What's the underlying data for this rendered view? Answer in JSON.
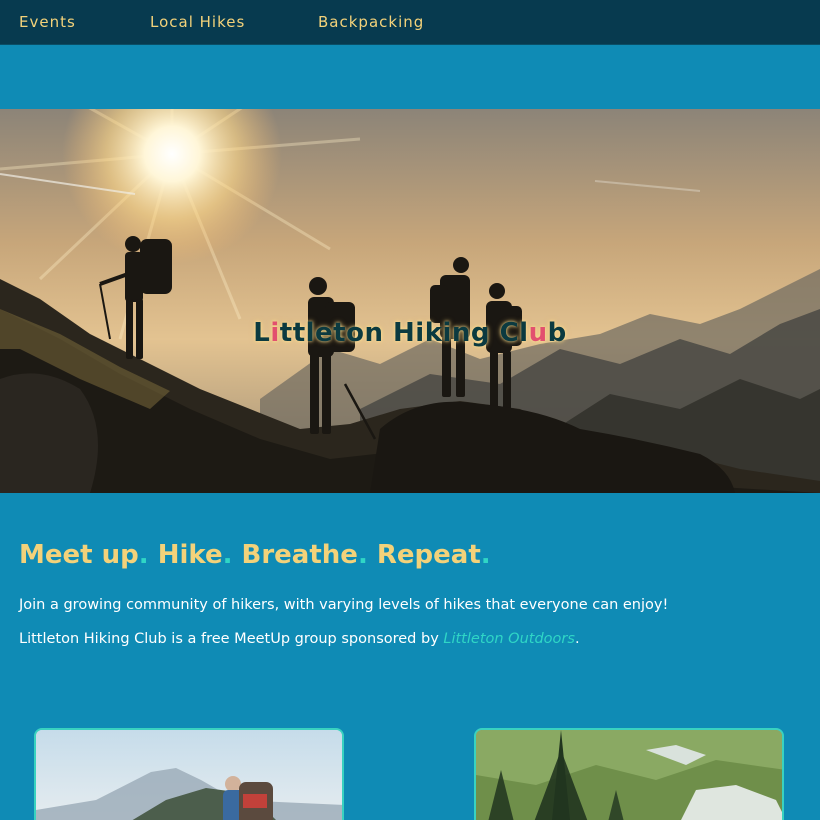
{
  "nav": {
    "items": [
      {
        "label": "Events"
      },
      {
        "label": "Local Hikes"
      },
      {
        "label": "Backpacking"
      }
    ]
  },
  "hero": {
    "title_parts": [
      "L",
      "i",
      "ttleton Hiking Cl",
      "u",
      "b"
    ],
    "image": "hikers-silhouette-sunset-photo"
  },
  "main": {
    "tagline": [
      "Meet up",
      ".",
      " Hike",
      ".",
      " Breathe",
      ".",
      " Repeat",
      "."
    ],
    "intro_line": "Join a growing community of hikers, with varying levels of hikes that everyone can enjoy!",
    "sponsor_prefix": "Littleton Hiking Club is a free MeetUp group sponsored by ",
    "sponsor_link": "Littleton Outdoors",
    "sponsor_suffix": "."
  },
  "cards": [
    {
      "image": "hiker-backpack-mountain-photo"
    },
    {
      "image": "alpine-meadow-trees-photo"
    }
  ],
  "colors": {
    "nav_bg": "#073a4f",
    "page_bg": "#0f8bb5",
    "accent_yellow": "#f3d27a",
    "accent_teal": "#2fd6c6",
    "accent_pink": "#e2506f"
  }
}
